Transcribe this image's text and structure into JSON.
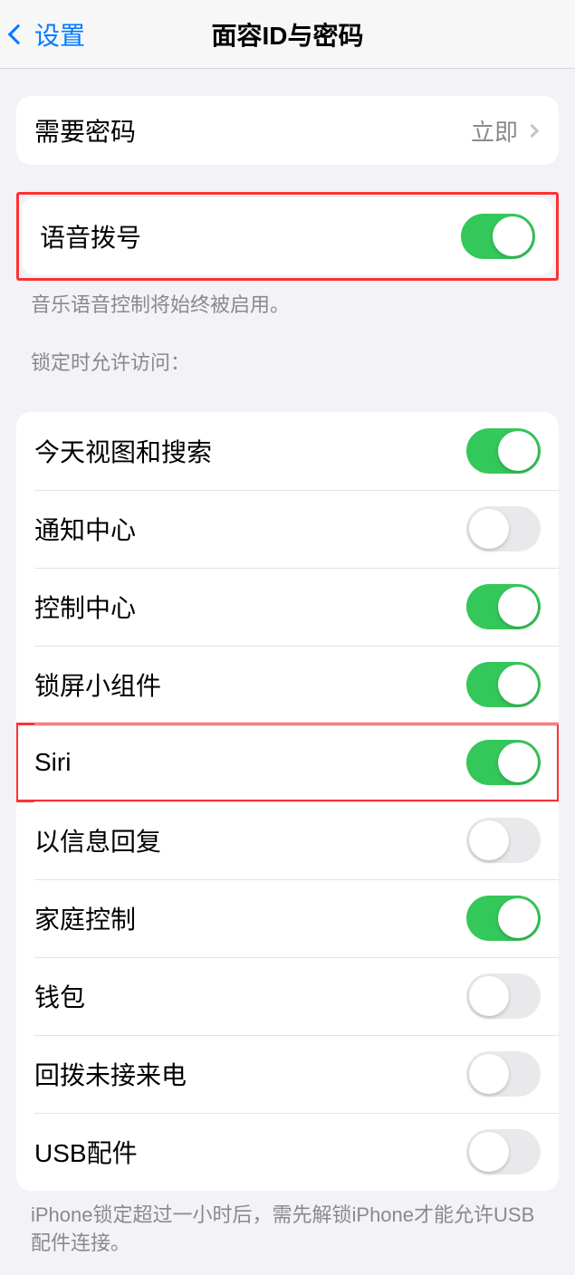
{
  "nav": {
    "back_label": "设置",
    "title": "面容ID与密码"
  },
  "group1": {
    "require_passcode": {
      "label": "需要密码",
      "value": "立即"
    }
  },
  "group2": {
    "voice_dial": {
      "label": "语音拨号",
      "on": true
    },
    "footer": "音乐语音控制将始终被启用。"
  },
  "group3": {
    "header": "锁定时允许访问：",
    "items": [
      {
        "label": "今天视图和搜索",
        "on": true,
        "name": "today-view-search"
      },
      {
        "label": "通知中心",
        "on": false,
        "name": "notification-center"
      },
      {
        "label": "控制中心",
        "on": true,
        "name": "control-center"
      },
      {
        "label": "锁屏小组件",
        "on": true,
        "name": "lock-screen-widgets"
      },
      {
        "label": "Siri",
        "on": true,
        "name": "siri",
        "highlight": true
      },
      {
        "label": "以信息回复",
        "on": false,
        "name": "reply-with-message"
      },
      {
        "label": "家庭控制",
        "on": true,
        "name": "home-control"
      },
      {
        "label": "钱包",
        "on": false,
        "name": "wallet"
      },
      {
        "label": "回拨未接来电",
        "on": false,
        "name": "return-missed-calls"
      },
      {
        "label": "USB配件",
        "on": false,
        "name": "usb-accessories"
      }
    ],
    "footer": "iPhone锁定超过一小时后，需先解锁iPhone才能允许USB配件连接。"
  }
}
